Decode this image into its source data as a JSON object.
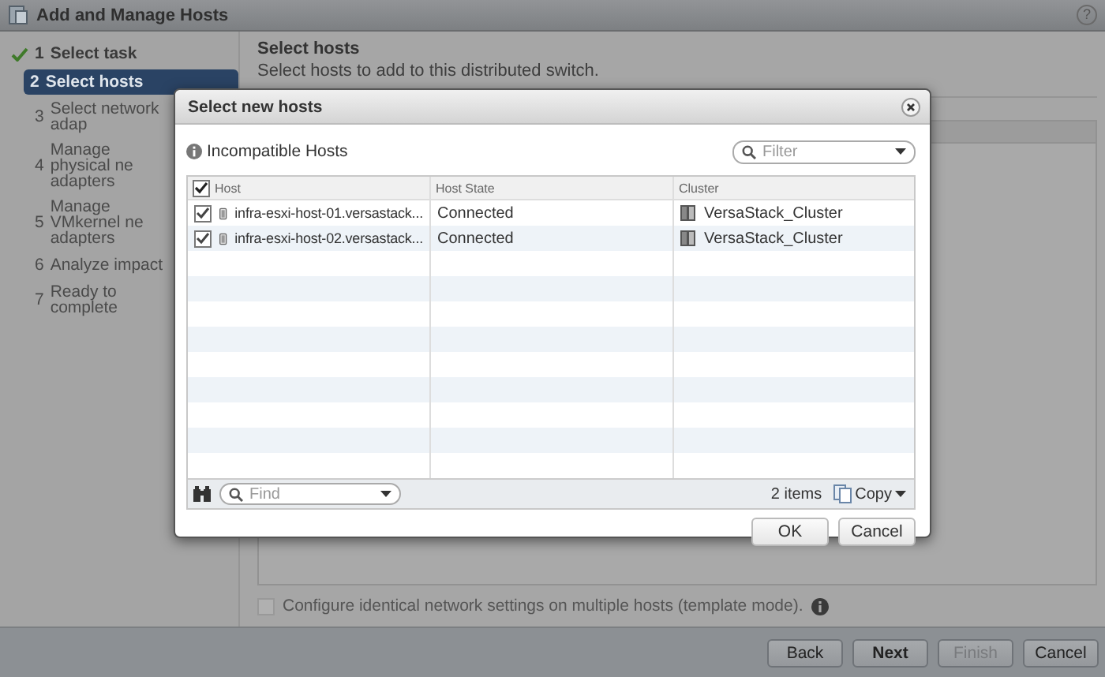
{
  "window": {
    "title": "Add and Manage Hosts",
    "help": "?"
  },
  "steps": [
    {
      "number": "1",
      "label": "Select task",
      "kind": "done",
      "selected": false
    },
    {
      "number": "2",
      "label": "Select hosts",
      "kind": "current",
      "selected": true
    },
    {
      "number": "3",
      "label": "Select network adap",
      "kind": "pending",
      "selected": false
    },
    {
      "number": "4",
      "label": "Manage physical ne adapters",
      "kind": "pending",
      "selected": false
    },
    {
      "number": "5",
      "label": "Manage VMkernel ne adapters",
      "kind": "pending",
      "selected": false
    },
    {
      "number": "6",
      "label": "Analyze impact",
      "kind": "pending",
      "selected": false
    },
    {
      "number": "7",
      "label": "Ready to complete",
      "kind": "pending",
      "selected": false
    }
  ],
  "page": {
    "title": "Select hosts",
    "subtitle": "Select hosts to add to this distributed switch."
  },
  "template_mode": {
    "label": "Configure identical network settings on multiple hosts (template mode).",
    "checked": false
  },
  "buttons": [
    {
      "label": "Back",
      "primary": false,
      "disabled": false
    },
    {
      "label": "Next",
      "primary": true,
      "disabled": false
    },
    {
      "label": "Finish",
      "primary": false,
      "disabled": true
    },
    {
      "label": "Cancel",
      "primary": false,
      "disabled": false
    }
  ],
  "dialog": {
    "title": "Select new hosts",
    "info_link": "Incompatible Hosts",
    "filter": {
      "placeholder": "Filter"
    },
    "table": {
      "columns": [
        "Host",
        "Host State",
        "Cluster"
      ],
      "all_checked": true,
      "rows": [
        {
          "host": "infra-esxi-host-01.versastack...",
          "state": "Connected",
          "cluster": "VersaStack_Cluster",
          "checked": true
        },
        {
          "host": "infra-esxi-host-02.versastack...",
          "state": "Connected",
          "cluster": "VersaStack_Cluster",
          "checked": true
        }
      ]
    },
    "find": {
      "placeholder": "Find"
    },
    "count": "2 items",
    "copy": "Copy",
    "buttons": [
      "OK",
      "Cancel"
    ]
  }
}
